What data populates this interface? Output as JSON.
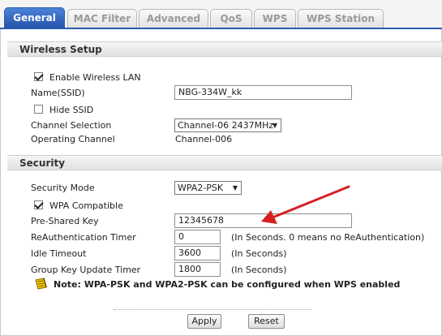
{
  "tabs": [
    {
      "label": "General",
      "active": true
    },
    {
      "label": "MAC Filter",
      "active": false
    },
    {
      "label": "Advanced",
      "active": false
    },
    {
      "label": "QoS",
      "active": false
    },
    {
      "label": "WPS",
      "active": false
    },
    {
      "label": "WPS Station",
      "active": false
    }
  ],
  "wireless": {
    "title": "Wireless Setup",
    "enable_label": "Enable Wireless LAN",
    "enable_checked": true,
    "ssid_label": "Name(SSID)",
    "ssid_value": "NBG-334W_kk",
    "hide_label": "Hide SSID",
    "hide_checked": false,
    "channel_label": "Channel Selection",
    "channel_value": "Channel-06 2437MHz",
    "operating_label": "Operating Channel",
    "operating_value": "Channel-006"
  },
  "security": {
    "title": "Security",
    "mode_label": "Security Mode",
    "mode_value": "WPA2-PSK",
    "wpa_compat_label": "WPA Compatible",
    "wpa_compat_checked": true,
    "psk_label": "Pre-Shared Key",
    "psk_value": "12345678",
    "reauth_label": "ReAuthentication Timer",
    "reauth_value": "0",
    "reauth_hint": "(In Seconds. 0 means no ReAuthentication)",
    "idle_label": "Idle Timeout",
    "idle_value": "3600",
    "idle_hint": "(In Seconds)",
    "group_label": "Group Key Update Timer",
    "group_value": "1800",
    "group_hint": "(In Seconds)"
  },
  "note": "Note: WPA-PSK and WPA2-PSK can be configured when WPS enabled",
  "buttons": {
    "apply": "Apply",
    "reset": "Reset"
  },
  "colors": {
    "tab_active": "#2a5db0",
    "arrow": "#d42020",
    "note_icon": "#e8b800"
  }
}
